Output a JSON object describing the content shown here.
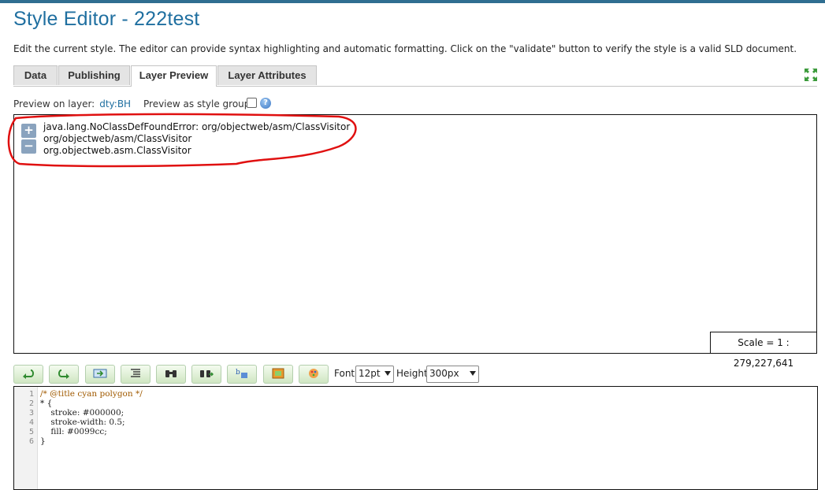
{
  "header": {
    "title": "Style Editor - 222test",
    "description": "Edit the current style. The editor can provide syntax highlighting and automatic formatting. Click on the \"validate\" button to verify the style is a valid SLD document."
  },
  "tabs": [
    {
      "label": "Data",
      "active": false
    },
    {
      "label": "Publishing",
      "active": false
    },
    {
      "label": "Layer Preview",
      "active": true
    },
    {
      "label": "Layer Attributes",
      "active": false
    }
  ],
  "preview": {
    "layer_label": "Preview on layer:",
    "layer_value": "dty:BH",
    "group_label": "Preview as style group:"
  },
  "map": {
    "zoom_in": "+",
    "zoom_out": "−",
    "errors": [
      "java.lang.NoClassDefFoundError: org/objectweb/asm/ClassVisitor",
      "org/objectweb/asm/ClassVisitor",
      "org.objectweb.asm.ClassVisitor"
    ],
    "scale": "Scale = 1 : 279,227,641"
  },
  "toolbar": {
    "buttons": [
      "undo-icon",
      "redo-icon",
      "goto-line-icon",
      "format-icon",
      "search-icon",
      "replace-icon",
      "color-swatch-icon",
      "image-icon",
      "palette-icon"
    ],
    "font_label": "Font",
    "font_value": "12pt",
    "height_label": "Height",
    "height_value": "300px"
  },
  "editor": {
    "lines": [
      {
        "num": "1",
        "text": "/* @title cyan polygon */"
      },
      {
        "num": "2",
        "text": "* {"
      },
      {
        "num": "3",
        "text": "    stroke: #000000;"
      },
      {
        "num": "4",
        "text": "    stroke-width: 0.5;"
      },
      {
        "num": "5",
        "text": "    fill: #0099cc;"
      },
      {
        "num": "6",
        "text": "}"
      }
    ]
  },
  "colors": {
    "title": "#1f6fa0",
    "annotation": "#e01010"
  }
}
